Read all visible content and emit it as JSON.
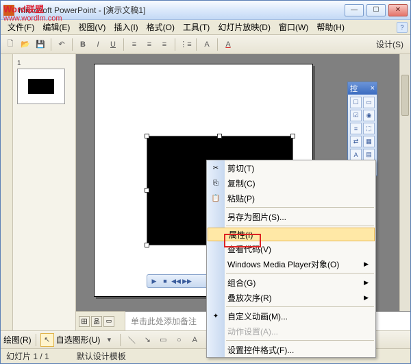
{
  "window": {
    "title": "Microsoft PowerPoint - [演示文稿1]"
  },
  "watermark": {
    "line1": "Word联盟",
    "line2": "www.wordlm.com"
  },
  "menu": {
    "file": "文件(F)",
    "edit": "编辑(E)",
    "view": "视图(V)",
    "insert": "插入(I)",
    "format": "格式(O)",
    "tools": "工具(T)",
    "slideshow": "幻灯片放映(D)",
    "window": "窗口(W)",
    "help": "帮助(H)"
  },
  "toolbar": {
    "design": "设计(S)"
  },
  "thumbnails": {
    "num1": "1"
  },
  "notes": {
    "placeholder": "单击此处添加备注"
  },
  "draw": {
    "label": "绘图(R)",
    "autoshape": "自选图形(U)"
  },
  "status": {
    "slide": "幻灯片 1 / 1",
    "template": "默认设计模板"
  },
  "ctrl_panel": {
    "title": "控",
    "btns": [
      "☐",
      "▭",
      "☑",
      "◉",
      "≡",
      "⬚",
      "⇄",
      "▦",
      "A",
      "▤",
      "⚒",
      "⋯"
    ]
  },
  "ctx": {
    "cut": "剪切(T)",
    "copy": "复制(C)",
    "paste": "粘贴(P)",
    "save_pic": "另存为图片(S)...",
    "props": "属性(I)",
    "view_code": "查看代码(V)",
    "wmp": "Windows Media Player对象(O)",
    "group": "组合(G)",
    "order": "叠放次序(R)",
    "anim": "自定义动画(M)...",
    "action": "动作设置(A)...",
    "format_ctrl": "设置控件格式(F)..."
  }
}
